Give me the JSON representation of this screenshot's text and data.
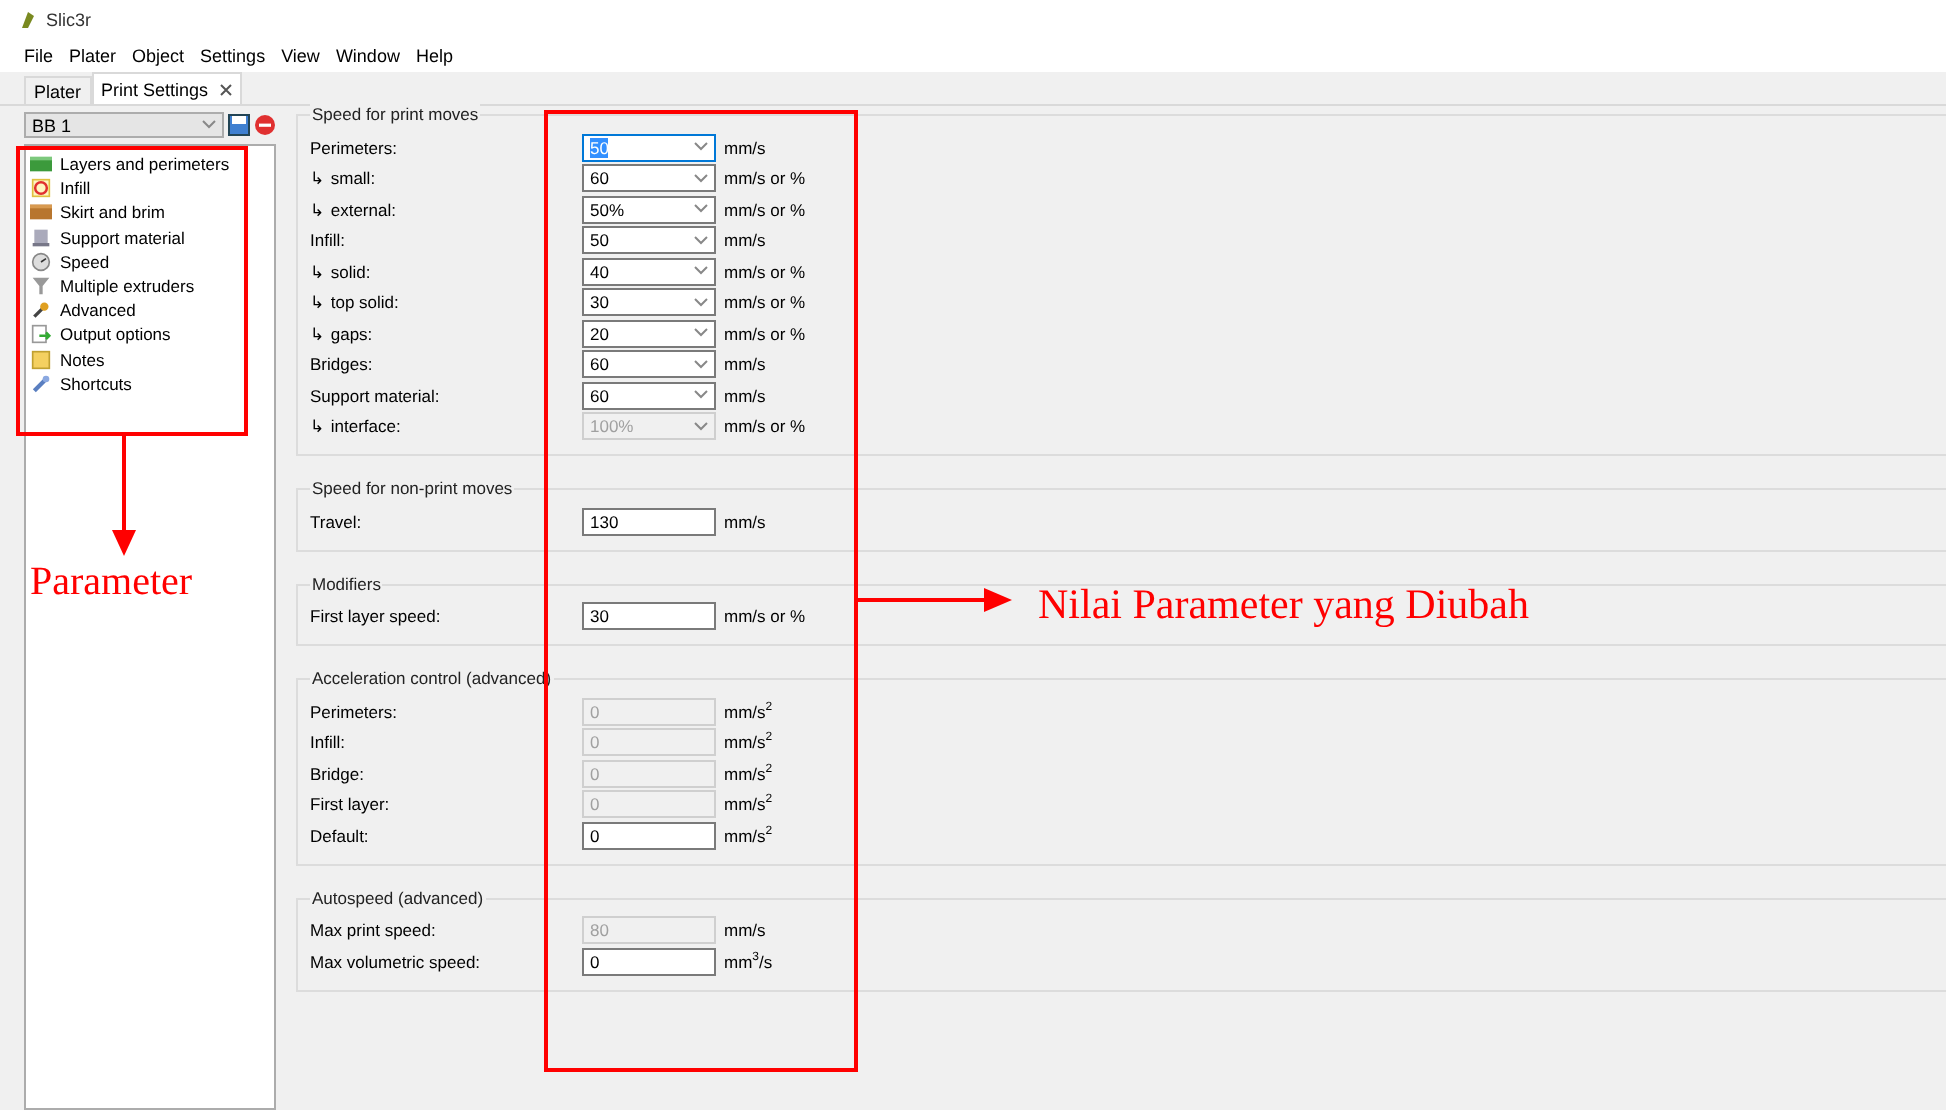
{
  "window": {
    "title": "Slic3r"
  },
  "menu": [
    "File",
    "Plater",
    "Object",
    "Settings",
    "View",
    "Window",
    "Help"
  ],
  "tabs": [
    {
      "label": "Plater",
      "selected": false
    },
    {
      "label": "Print Settings",
      "selected": true
    }
  ],
  "preset": {
    "value": "BB 1"
  },
  "tree": [
    "Layers and perimeters",
    "Infill",
    "Skirt and brim",
    "Support material",
    "Speed",
    "Multiple extruders",
    "Advanced",
    "Output options",
    "Notes",
    "Shortcuts"
  ],
  "groups": [
    {
      "title": "Speed for print moves",
      "rows": [
        {
          "label": "Perimeters:",
          "value": "50",
          "unit": "mm/s",
          "kind": "combo",
          "disabled": false,
          "focused": true
        },
        {
          "label": "↳ small:",
          "value": "60",
          "unit": "mm/s or %",
          "kind": "combo",
          "disabled": false,
          "focused": false
        },
        {
          "label": "↳ external:",
          "value": "50%",
          "unit": "mm/s or %",
          "kind": "combo",
          "disabled": false,
          "focused": false
        },
        {
          "label": "Infill:",
          "value": "50",
          "unit": "mm/s",
          "kind": "combo",
          "disabled": false,
          "focused": false
        },
        {
          "label": "↳ solid:",
          "value": "40",
          "unit": "mm/s or %",
          "kind": "combo",
          "disabled": false,
          "focused": false
        },
        {
          "label": "↳ top solid:",
          "value": "30",
          "unit": "mm/s or %",
          "kind": "combo",
          "disabled": false,
          "focused": false
        },
        {
          "label": "↳ gaps:",
          "value": "20",
          "unit": "mm/s or %",
          "kind": "combo",
          "disabled": false,
          "focused": false
        },
        {
          "label": "Bridges:",
          "value": "60",
          "unit": "mm/s",
          "kind": "combo",
          "disabled": false,
          "focused": false
        },
        {
          "label": "Support material:",
          "value": "60",
          "unit": "mm/s",
          "kind": "combo",
          "disabled": false,
          "focused": false
        },
        {
          "label": "↳ interface:",
          "value": "100%",
          "unit": "mm/s or %",
          "kind": "combo",
          "disabled": true,
          "focused": false
        }
      ]
    },
    {
      "title": "Speed for non-print moves",
      "rows": [
        {
          "label": "Travel:",
          "value": "130",
          "unit": "mm/s",
          "kind": "text",
          "disabled": false,
          "focused": false
        }
      ]
    },
    {
      "title": "Modifiers",
      "rows": [
        {
          "label": "First layer speed:",
          "value": "30",
          "unit": "mm/s or %",
          "kind": "text",
          "disabled": false,
          "focused": false
        }
      ]
    },
    {
      "title": "Acceleration control (advanced)",
      "rows": [
        {
          "label": "Perimeters:",
          "value": "0",
          "unit": "mm/s$^{2}$",
          "kind": "text",
          "disabled": true,
          "focused": false
        },
        {
          "label": "Infill:",
          "value": "0",
          "unit": "mm/s$^{2}$",
          "kind": "text",
          "disabled": true,
          "focused": false
        },
        {
          "label": "Bridge:",
          "value": "0",
          "unit": "mm/s$^{2}$",
          "kind": "text",
          "disabled": true,
          "focused": false
        },
        {
          "label": "First layer:",
          "value": "0",
          "unit": "mm/s$^{2}$",
          "kind": "text",
          "disabled": true,
          "focused": false
        },
        {
          "label": "Default:",
          "value": "0",
          "unit": "mm/s$^{2}$",
          "kind": "text",
          "disabled": false,
          "focused": false
        }
      ]
    },
    {
      "title": "Autospeed (advanced)",
      "rows": [
        {
          "label": "Max print speed:",
          "value": "80",
          "unit": "mm/s",
          "kind": "text",
          "disabled": true,
          "focused": false
        },
        {
          "label": "Max volumetric speed:",
          "value": "0",
          "unit": "mm$^{3}$/s",
          "kind": "text",
          "disabled": false,
          "focused": false
        }
      ]
    }
  ],
  "annotations": {
    "left_label": "Parameter",
    "right_label": "Nilai Parameter yang Diubah"
  }
}
